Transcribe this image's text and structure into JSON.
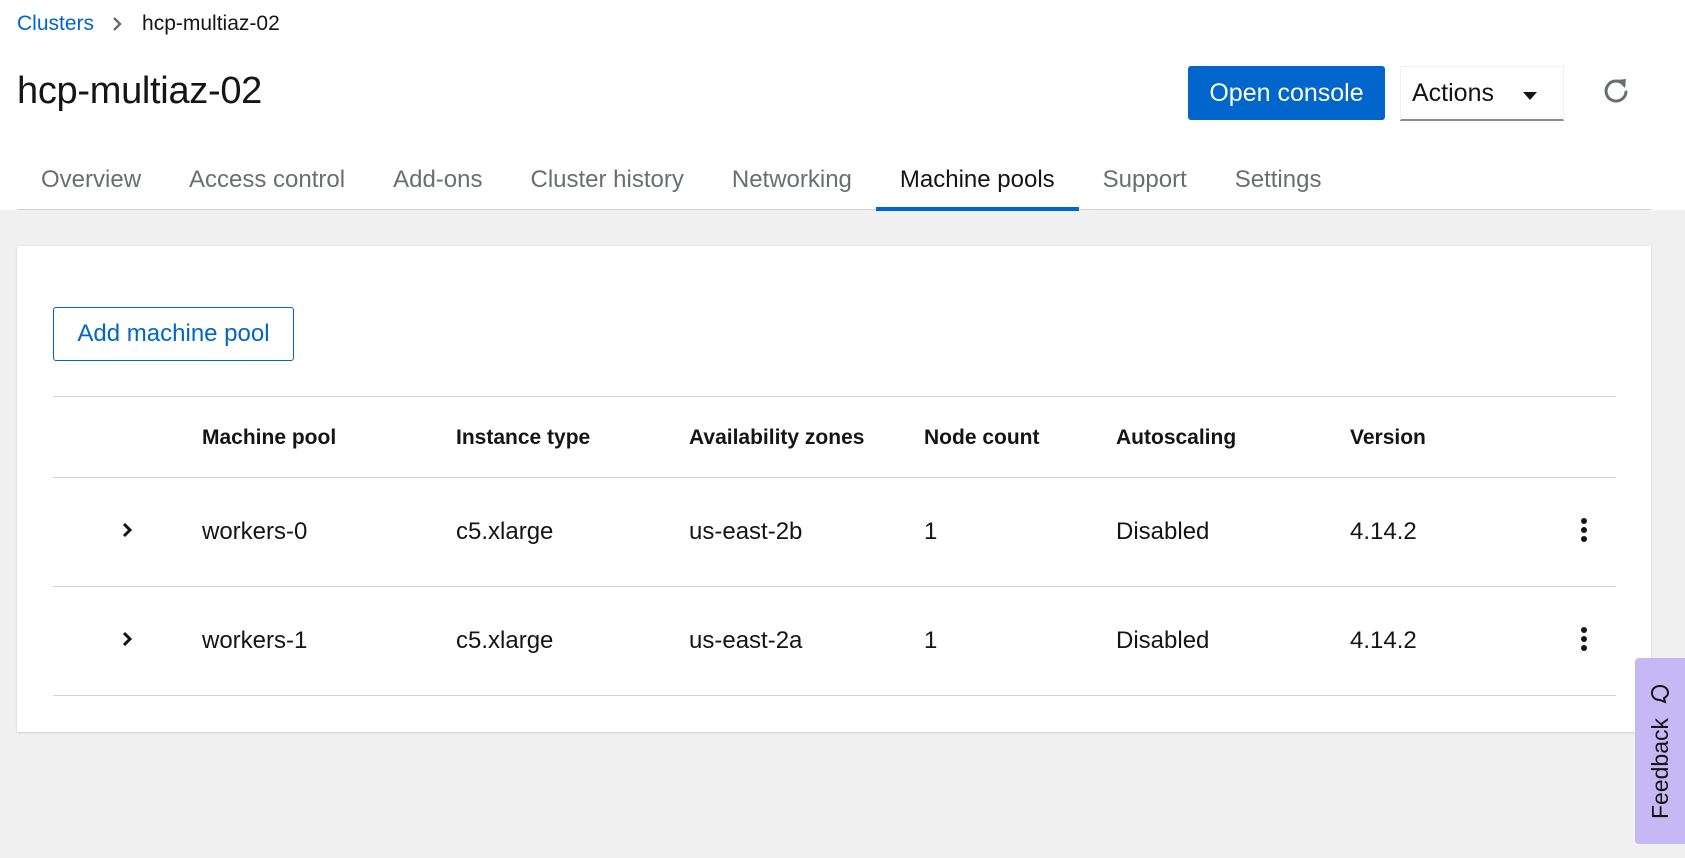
{
  "breadcrumb": {
    "parent": "Clusters",
    "current": "hcp-multiaz-02"
  },
  "header": {
    "title": "hcp-multiaz-02",
    "open_console": "Open console",
    "actions": "Actions"
  },
  "tabs": [
    {
      "label": "Overview"
    },
    {
      "label": "Access control"
    },
    {
      "label": "Add-ons"
    },
    {
      "label": "Cluster history"
    },
    {
      "label": "Networking"
    },
    {
      "label": "Machine pools"
    },
    {
      "label": "Support"
    },
    {
      "label": "Settings"
    }
  ],
  "active_tab": "Machine pools",
  "machine_pools": {
    "add_button": "Add machine pool",
    "columns": {
      "pool": "Machine pool",
      "type": "Instance type",
      "az": "Availability zones",
      "nodes": "Node count",
      "autoscaling": "Autoscaling",
      "version": "Version"
    },
    "rows": [
      {
        "pool": "workers-0",
        "type": "c5.xlarge",
        "az": "us-east-2b",
        "nodes": "1",
        "autoscaling": "Disabled",
        "version": "4.14.2"
      },
      {
        "pool": "workers-1",
        "type": "c5.xlarge",
        "az": "us-east-2a",
        "nodes": "1",
        "autoscaling": "Disabled",
        "version": "4.14.2"
      }
    ]
  },
  "feedback": {
    "label": "Feedback"
  },
  "icons": {
    "breadcrumb_sep": "chevron-right-icon",
    "dropdown": "caret-down-icon",
    "refresh": "refresh-icon",
    "expand": "chevron-right-icon",
    "row_menu": "kebab-icon",
    "feedback": "chat-icon"
  },
  "colors": {
    "primary": "#0066cc",
    "feedback_bg": "#c6b8f5",
    "page_bg": "#f0f0f0"
  }
}
